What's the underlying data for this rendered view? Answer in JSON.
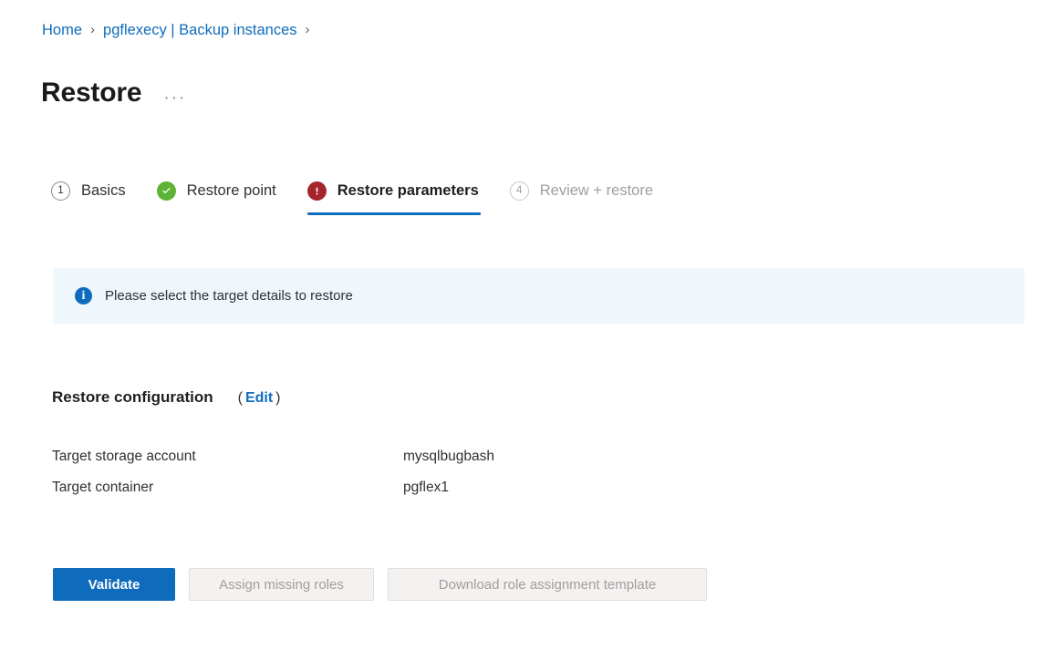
{
  "breadcrumb": {
    "items": [
      {
        "label": "Home",
        "type": "link"
      },
      {
        "label": "pgflexecy | Backup instances",
        "type": "link"
      }
    ],
    "separator": "›",
    "trailing_separator": "›"
  },
  "header": {
    "title": "Restore",
    "more_actions": "···"
  },
  "wizard": {
    "steps": [
      {
        "label": "Basics",
        "indicator": "1",
        "icon": "number-circle-icon",
        "state": "visited"
      },
      {
        "label": "Restore point",
        "indicator": "✓",
        "icon": "check-circle-icon",
        "state": "complete"
      },
      {
        "label": "Restore parameters",
        "indicator": "!",
        "icon": "error-circle-icon",
        "state": "current"
      },
      {
        "label": "Review + restore",
        "indicator": "4",
        "icon": "number-circle-icon",
        "state": "disabled"
      }
    ]
  },
  "info_banner": {
    "icon": "info-circle-icon",
    "message": "Please select the target details to restore"
  },
  "restore_configuration": {
    "title": "Restore configuration",
    "edit_open_paren": "(",
    "edit_label": "Edit",
    "edit_close_paren": ")",
    "rows": [
      {
        "label": "Target storage account",
        "value": "mysqlbugbash"
      },
      {
        "label": "Target container",
        "value": "pgflex1"
      }
    ]
  },
  "actions": {
    "validate_label": "Validate",
    "assign_roles_label": "Assign missing roles",
    "download_template_label": "Download role assignment template"
  },
  "colors": {
    "accent_blue": "#0f6cbd",
    "link_blue": "#0f6cbd",
    "success_green": "#5db335",
    "error_red": "#a4262c",
    "banner_bg": "#eff6fc",
    "disabled_bg": "#f3f2f1",
    "disabled_text": "#a19f9d",
    "text_primary": "#323130"
  }
}
